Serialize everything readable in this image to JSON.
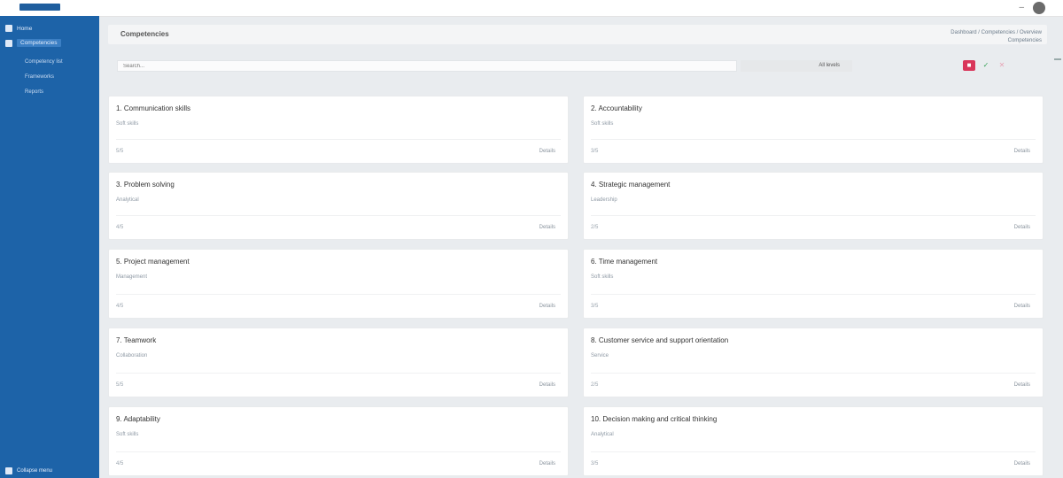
{
  "app": {
    "logo_sub": "",
    "minimize": "–"
  },
  "sidebar": {
    "items": [
      {
        "label": "Home",
        "icon": "home-icon"
      },
      {
        "label": "Competencies",
        "icon": "grid-icon",
        "active": true
      }
    ],
    "sub_items": [
      {
        "label": "Competency list"
      },
      {
        "label": "Frameworks"
      },
      {
        "label": "Reports"
      }
    ],
    "bottom": {
      "label": "Collapse menu",
      "icon": "sidebar-icon"
    }
  },
  "header": {
    "title": "Competencies",
    "breadcrumb_line1": "Dashboard / Competencies / Overview",
    "breadcrumb_line2": "Competencies"
  },
  "filters": {
    "search_placeholder": "Search...",
    "select_value": "All levels",
    "btn_red": "■",
    "btn_green": "✓",
    "btn_pink": "✕"
  },
  "columns": [
    {
      "label": ""
    },
    {
      "label": ""
    }
  ],
  "cards": [
    {
      "title": "1. Communication skills",
      "sub": "Soft skills",
      "foot_l": "5/5",
      "foot_r": "Details"
    },
    {
      "title": "2. Accountability",
      "sub": "Soft skills",
      "foot_l": "3/5",
      "foot_r": "Details"
    },
    {
      "title": "3. Problem solving",
      "sub": "Analytical",
      "foot_l": "4/5",
      "foot_r": "Details"
    },
    {
      "title": "4. Strategic management",
      "sub": "Leadership",
      "foot_l": "2/5",
      "foot_r": "Details"
    },
    {
      "title": "5. Project management",
      "sub": "Management",
      "foot_l": "4/5",
      "foot_r": "Details"
    },
    {
      "title": "6. Time management",
      "sub": "Soft skills",
      "foot_l": "3/5",
      "foot_r": "Details"
    },
    {
      "title": "7. Teamwork",
      "sub": "Collaboration",
      "foot_l": "5/5",
      "foot_r": "Details"
    },
    {
      "title": "8. Customer service and support orientation",
      "sub": "Service",
      "foot_l": "2/5",
      "foot_r": "Details"
    },
    {
      "title": "9. Adaptability",
      "sub": "Soft skills",
      "foot_l": "4/5",
      "foot_r": "Details"
    },
    {
      "title": "10. Decision making and critical thinking",
      "sub": "Analytical",
      "foot_l": "3/5",
      "foot_r": "Details"
    }
  ]
}
